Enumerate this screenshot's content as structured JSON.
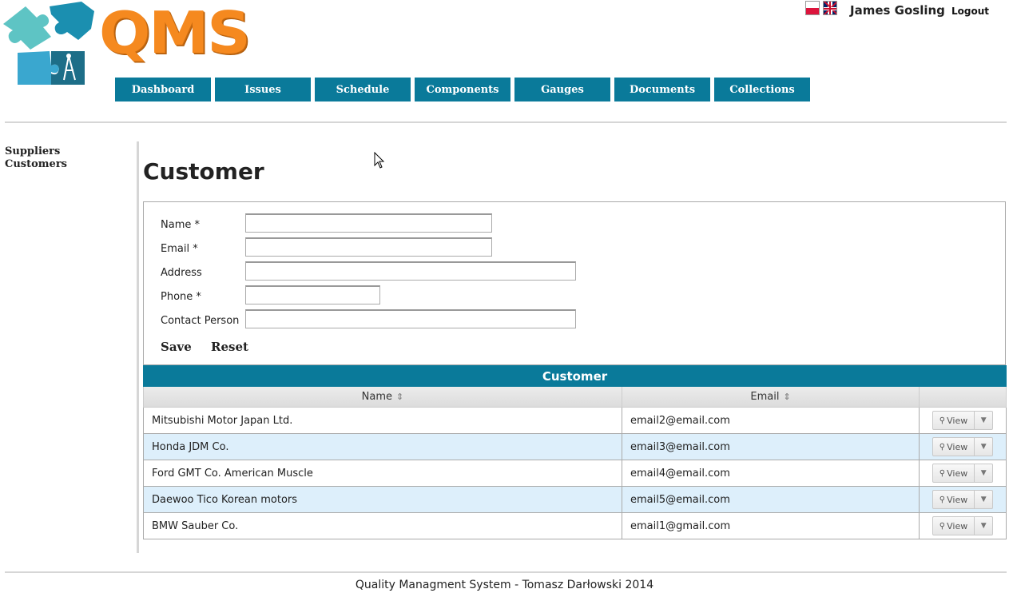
{
  "app": {
    "logo_text": "QMS"
  },
  "user": {
    "name": "James Gosling",
    "logout_label": "Logout"
  },
  "languages": [
    {
      "code": "pl",
      "icon": "poland-flag-icon"
    },
    {
      "code": "en",
      "icon": "uk-flag-icon"
    }
  ],
  "nav": {
    "items": [
      {
        "label": "Dashboard"
      },
      {
        "label": "Issues"
      },
      {
        "label": "Schedule"
      },
      {
        "label": "Components"
      },
      {
        "label": "Gauges"
      },
      {
        "label": "Documents"
      },
      {
        "label": "Collections"
      }
    ]
  },
  "sidebar": {
    "items": [
      {
        "label": "Suppliers"
      },
      {
        "label": "Customers"
      }
    ]
  },
  "page": {
    "title": "Customer"
  },
  "form": {
    "fields": [
      {
        "label": "Name *",
        "value": ""
      },
      {
        "label": "Email *",
        "value": ""
      },
      {
        "label": "Address",
        "value": ""
      },
      {
        "label": "Phone *",
        "value": ""
      },
      {
        "label": "Contact Person",
        "value": ""
      }
    ],
    "save_label": "Save",
    "reset_label": "Reset"
  },
  "table": {
    "caption": "Customer",
    "columns": [
      "Name",
      "Email",
      ""
    ],
    "sort_icon": "sort-icon",
    "view_label": "View",
    "rows": [
      {
        "name": "Mitsubishi Motor Japan Ltd.",
        "email": "email2@email.com"
      },
      {
        "name": "Honda JDM Co.",
        "email": "email3@email.com"
      },
      {
        "name": "Ford GMT Co. American Muscle",
        "email": "email4@email.com"
      },
      {
        "name": "Daewoo Tico Korean motors",
        "email": "email5@email.com"
      },
      {
        "name": "BMW Sauber Co.",
        "email": "email1@gmail.com"
      }
    ]
  },
  "footer": {
    "text": "Quality Managment System - Tomasz Darłowski 2014"
  },
  "colors": {
    "accent": "#0a7a9a",
    "logo": "#f5891f",
    "row_alt": "#ddeffb"
  }
}
